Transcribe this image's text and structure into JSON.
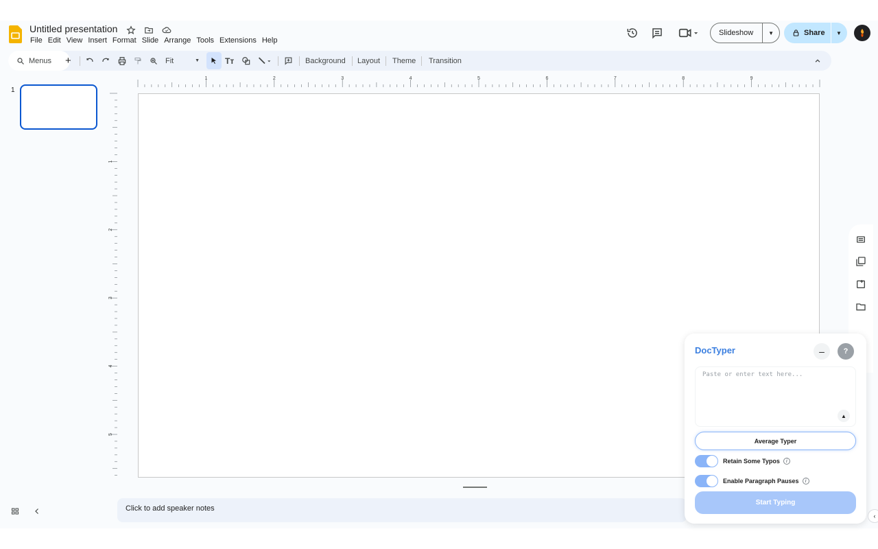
{
  "app": {
    "title": "Untitled presentation",
    "menu": [
      "File",
      "Edit",
      "View",
      "Insert",
      "Format",
      "Slide",
      "Arrange",
      "Tools",
      "Extensions",
      "Help"
    ],
    "brand_color": "#f4b400"
  },
  "header": {
    "slideshow_label": "Slideshow",
    "share_label": "Share"
  },
  "toolbar": {
    "menus_label": "Menus",
    "zoom_label": "Fit",
    "background_label": "Background",
    "layout_label": "Layout",
    "theme_label": "Theme",
    "transition_label": "Transition"
  },
  "slides": {
    "items": [
      {
        "number": "1"
      }
    ]
  },
  "ruler": {
    "horizontal": [
      "1",
      "2",
      "3",
      "4",
      "5",
      "6",
      "7",
      "8",
      "9"
    ],
    "vertical": [
      "1",
      "2",
      "3",
      "4",
      "5"
    ]
  },
  "notes": {
    "placeholder": "Click to add speaker notes"
  },
  "doctyper": {
    "title": "DocTyper",
    "textarea_placeholder": "Paste or enter text here...",
    "typer_mode": "Average Typer",
    "toggle_typos_label": "Retain Some Typos",
    "toggle_typos_on": true,
    "toggle_pauses_label": "Enable Paragraph Pauses",
    "toggle_pauses_on": true,
    "start_label": "Start Typing",
    "accent": "#3b7fe0"
  }
}
